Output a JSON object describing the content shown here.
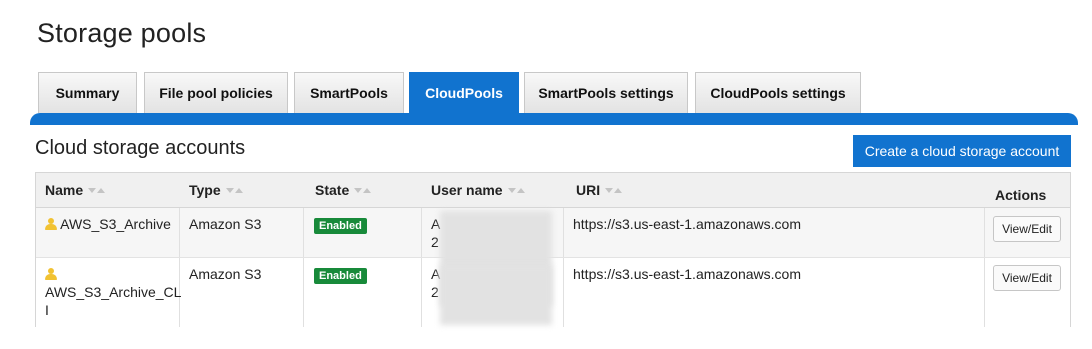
{
  "page_title": "Storage pools",
  "tabs": [
    {
      "label": "Summary",
      "active": false
    },
    {
      "label": "File pool policies",
      "active": false
    },
    {
      "label": "SmartPools",
      "active": false
    },
    {
      "label": "CloudPools",
      "active": true
    },
    {
      "label": "SmartPools settings",
      "active": false
    },
    {
      "label": "CloudPools settings",
      "active": false
    }
  ],
  "section_title": "Cloud storage accounts",
  "create_button": "Create a cloud storage account",
  "table": {
    "columns": [
      "Name",
      "Type",
      "State",
      "User name",
      "URI",
      "Actions"
    ],
    "rows": [
      {
        "name": "AWS_S3_Archive",
        "type": "Amazon S3",
        "state": "Enabled",
        "user_line1": "A",
        "user_line2": "2",
        "uri": "https://s3.us-east-1.amazonaws.com",
        "action": "View/Edit"
      },
      {
        "name_line1": "AWS_S3_Archive_CL",
        "name_line2": "I",
        "type": "Amazon S3",
        "state": "Enabled",
        "user_line1": "A",
        "user_line2": "2",
        "uri": "https://s3.us-east-1.amazonaws.com",
        "action": "View/Edit"
      }
    ]
  },
  "colors": {
    "accent": "#1173cf",
    "enabled_badge": "#188a3a",
    "user_icon": "#f1c232"
  },
  "icons": {
    "account": "user-icon",
    "sort": "sort-arrows-icon"
  }
}
